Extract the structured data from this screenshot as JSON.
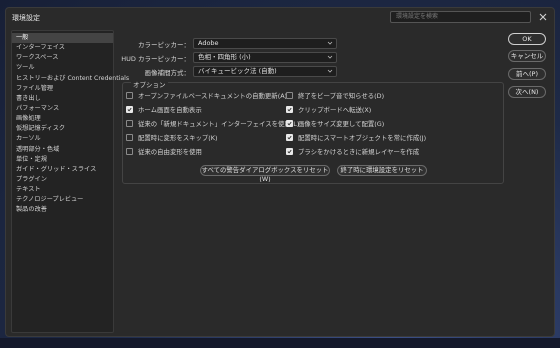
{
  "window": {
    "title": "環境設定",
    "search_placeholder": "環境設定を検索"
  },
  "sidebar": {
    "items": [
      {
        "label": "一般",
        "selected": true
      },
      {
        "label": "インターフェイス"
      },
      {
        "label": "ワークスペース"
      },
      {
        "label": "ツール"
      },
      {
        "label": "ヒストリーおよび Content Credentials"
      },
      {
        "label": "ファイル管理"
      },
      {
        "label": "書き出し"
      },
      {
        "label": "パフォーマンス"
      },
      {
        "label": "画像処理"
      },
      {
        "label": "仮想記憶ディスク"
      },
      {
        "label": "カーソル"
      },
      {
        "label": "透明部分・色域"
      },
      {
        "label": "単位・定規"
      },
      {
        "label": "ガイド・グリッド・スライス"
      },
      {
        "label": "プラグイン"
      },
      {
        "label": "テキスト"
      },
      {
        "label": "テクノロジープレビュー"
      },
      {
        "label": "製品の改善"
      }
    ]
  },
  "general": {
    "color_picker_label": "カラーピッカー：",
    "color_picker_value": "Adobe",
    "hud_picker_label": "HUD カラーピッカー：",
    "hud_picker_value": "色相・四角形 (小)",
    "interpolation_label": "画像補間方式：",
    "interpolation_value": "バイキュービック法 (自動)"
  },
  "options": {
    "title": "オプション",
    "left": [
      {
        "label": "オープンファイルベースドキュメントの自動更新(A)",
        "checked": false
      },
      {
        "label": "ホーム画面を自動表示",
        "checked": true
      },
      {
        "label": "従来の「新規ドキュメント」インターフェイスを使用(L)",
        "checked": false
      },
      {
        "label": "配置時に変形をスキップ(K)",
        "checked": false
      },
      {
        "label": "従来の自由変形を使用",
        "checked": false
      }
    ],
    "right": [
      {
        "label": "終了をビープ音で知らせる(D)",
        "checked": false
      },
      {
        "label": "クリップボードへ転送(X)",
        "checked": true
      },
      {
        "label": "画像をサイズ変更して配置(G)",
        "checked": true
      },
      {
        "label": "配置時にスマートオブジェクトを常に作成(J)",
        "checked": true
      },
      {
        "label": "ブラシをかけるときに新規レイヤーを作成",
        "checked": true
      }
    ]
  },
  "buttons": {
    "reset_warnings": "すべての警告ダイアログボックスをリセット (W)",
    "reset_on_quit": "終了時に環境設定をリセット",
    "ok": "OK",
    "cancel": "キャンセル",
    "prev": "前へ(P)",
    "next": "次へ(N)"
  }
}
